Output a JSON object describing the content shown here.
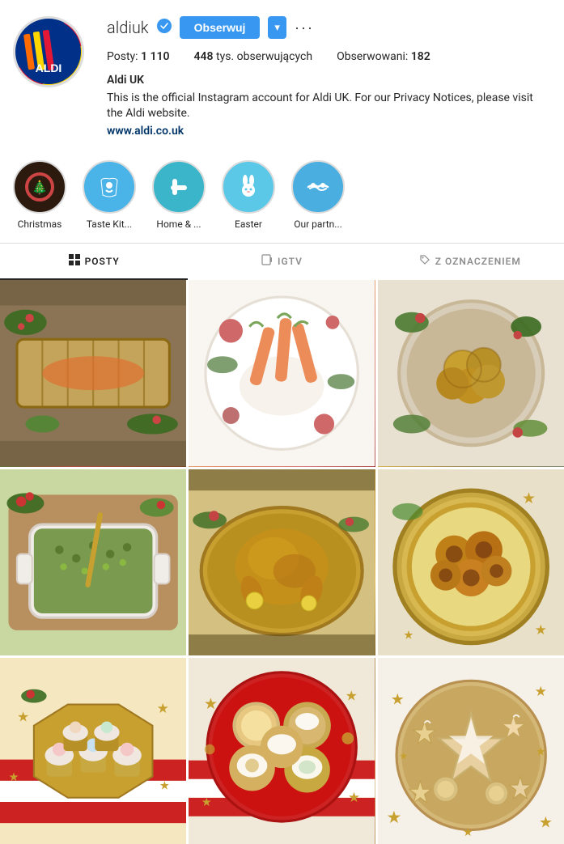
{
  "profile": {
    "username": "aldiuk",
    "verified": true,
    "follow_label": "Obserwuj",
    "dropdown_label": "▾",
    "more_label": "···",
    "stats": {
      "posts_label": "Posty:",
      "posts_count": "1 110",
      "followers_label": "tys. obserwujących",
      "followers_count": "448",
      "following_label": "Obserwowani:",
      "following_count": "182"
    },
    "bio": {
      "name": "Aldi UK",
      "text": "This is the official Instagram account for Aldi UK. For our Privacy Notices, please visit the Aldi website.",
      "link": "www.aldi.co.uk"
    }
  },
  "stories": [
    {
      "id": "christmas",
      "label": "Christmas",
      "bg": "christmas-bg",
      "icon": "🎄"
    },
    {
      "id": "taste-kit",
      "label": "Taste Kit...",
      "bg": "blue-bg",
      "icon": "🍽️"
    },
    {
      "id": "home",
      "label": "Home & ...",
      "bg": "teal-bg",
      "icon": "🔧"
    },
    {
      "id": "easter",
      "label": "Easter",
      "bg": "lightblue-bg",
      "icon": "🐰"
    },
    {
      "id": "partners",
      "label": "Our partn...",
      "bg": "skyblue-bg",
      "icon": "🤝"
    }
  ],
  "tabs": [
    {
      "id": "posts",
      "label": "POSTY",
      "active": true
    },
    {
      "id": "igtv",
      "label": "IGTV",
      "active": false
    },
    {
      "id": "tagged",
      "label": "Z OZNACZENIEM",
      "active": false
    }
  ],
  "grid": [
    {
      "id": 1,
      "cls": "food-1",
      "alt": "Christmas food pastry"
    },
    {
      "id": 2,
      "cls": "food-2",
      "alt": "Carrots with dip"
    },
    {
      "id": 3,
      "cls": "food-3",
      "alt": "Roast potatoes"
    },
    {
      "id": 4,
      "cls": "food-4",
      "alt": "Stuffing dish"
    },
    {
      "id": 5,
      "cls": "food-5",
      "alt": "Roast chicken"
    },
    {
      "id": 6,
      "cls": "food-6",
      "alt": "Yorkshire puddings"
    },
    {
      "id": 7,
      "cls": "food-7",
      "alt": "Cupcakes"
    },
    {
      "id": 8,
      "cls": "food-8",
      "alt": "Cookies plate"
    },
    {
      "id": 9,
      "cls": "food-9",
      "alt": "Star cookies"
    }
  ],
  "colors": {
    "follow_btn": "#3897f0",
    "active_tab": "#262626",
    "verified": "#3897f0"
  }
}
